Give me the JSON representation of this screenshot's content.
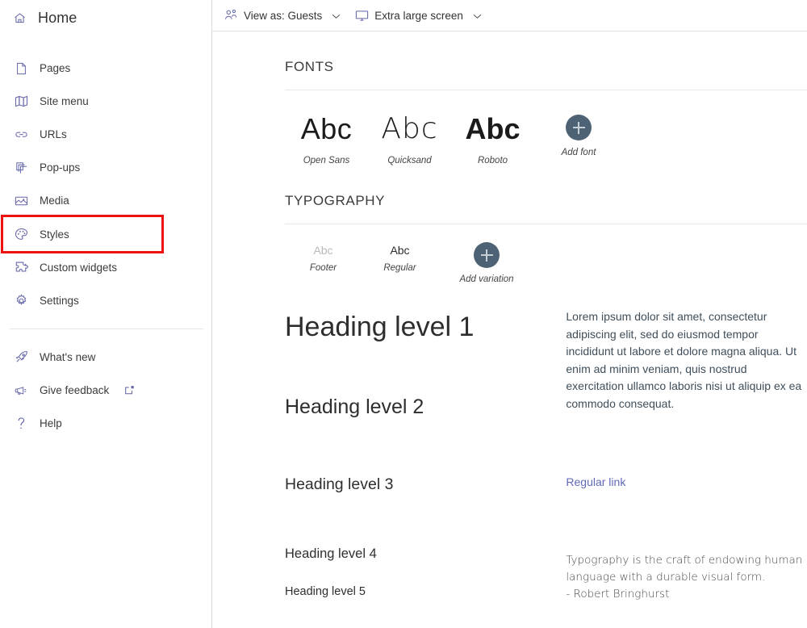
{
  "sidebar": {
    "home": {
      "label": "Home",
      "icon": "home-icon"
    },
    "items": [
      {
        "label": "Pages",
        "icon": "page-icon",
        "selected": false
      },
      {
        "label": "Site menu",
        "icon": "site-menu-icon",
        "selected": false
      },
      {
        "label": "URLs",
        "icon": "link-icon",
        "selected": false
      },
      {
        "label": "Pop-ups",
        "icon": "popup-icon",
        "selected": false
      },
      {
        "label": "Media",
        "icon": "media-image-icon",
        "selected": false
      },
      {
        "label": "Styles",
        "icon": "palette-icon",
        "selected": true
      },
      {
        "label": "Custom widgets",
        "icon": "puzzle-icon",
        "selected": false
      },
      {
        "label": "Settings",
        "icon": "gear-icon",
        "selected": false
      }
    ],
    "secondary_items": [
      {
        "label": "What's new",
        "icon": "rocket-icon",
        "external": false
      },
      {
        "label": "Give feedback",
        "icon": "megaphone-icon",
        "external": true
      },
      {
        "label": "Help",
        "icon": "question-icon",
        "external": false
      }
    ],
    "selection_highlight_color": "#ee1111",
    "icon_color": "#6264a7"
  },
  "toolbar": {
    "view_as": {
      "label": "View as: Guests",
      "icon": "people-icon",
      "chevron": "chevron-down-icon"
    },
    "screen_size": {
      "label": "Extra large screen",
      "icon": "monitor-icon",
      "chevron": "chevron-down-icon"
    }
  },
  "fonts_section": {
    "title": "FONTS",
    "fonts": [
      {
        "sample": "Abc",
        "name": "Open Sans"
      },
      {
        "sample": "Abc",
        "name": "Quicksand"
      },
      {
        "sample": "Abc",
        "name": "Roboto"
      }
    ],
    "add": {
      "label": "Add font",
      "icon": "plus-icon",
      "circle_color": "#4d6274"
    }
  },
  "typography_section": {
    "title": "TYPOGRAPHY",
    "variations": [
      {
        "sample": "Abc",
        "name": "Footer"
      },
      {
        "sample": "Abc",
        "name": "Regular"
      }
    ],
    "add": {
      "label": "Add variation",
      "icon": "plus-icon",
      "circle_color": "#4d6274"
    },
    "headings": [
      {
        "text": "Heading level 1"
      },
      {
        "text": "Heading level 2"
      },
      {
        "text": "Heading level 3"
      },
      {
        "text": "Heading level 4"
      },
      {
        "text": "Heading level 5"
      }
    ],
    "body_text": "Lorem ipsum dolor sit amet, consectetur adipiscing elit, sed do eiusmod tempor incididunt ut labore et dolore magna aliqua. Ut enim ad minim veniam, quis nostrud exercitation ullamco laboris nisi ut aliquip ex ea commodo consequat.",
    "link_text": "Regular link",
    "link_color": "#6169b8",
    "quote_text": "Typography is the craft of endowing human language with a durable visual form.\n- Robert Bringhurst"
  }
}
